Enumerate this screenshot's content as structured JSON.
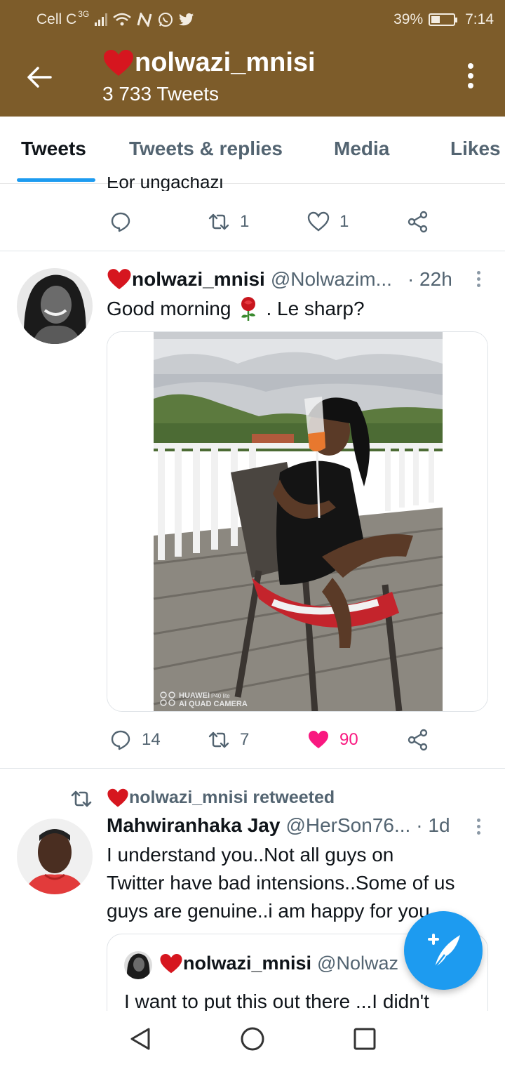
{
  "status_bar": {
    "carrier": "Cell C",
    "network": "3G",
    "battery": "39%",
    "battery_level": 0.39,
    "time": "7:14"
  },
  "header": {
    "name": "nolwazi_mnisi",
    "tweet_count": "3 733 Tweets"
  },
  "tabs": [
    {
      "label": "Tweets",
      "active": true
    },
    {
      "label": "Tweets & replies",
      "active": false
    },
    {
      "label": "Media",
      "active": false
    },
    {
      "label": "Likes",
      "active": false
    }
  ],
  "prev_tweet": {
    "cut_text": "Eor ungachazi",
    "retweets": "1",
    "likes": "1"
  },
  "tweet1": {
    "name": "nolwazi_mnisi",
    "handle": "@Nolwazim...",
    "time": "· 22h",
    "text_before": "Good morning",
    "text_after": ". Le sharp?",
    "watermark_line1": "HUAWEI",
    "watermark_model": "P40 lite",
    "watermark_line2": "AI QUAD CAMERA",
    "replies": "14",
    "retweets": "7",
    "likes": "90"
  },
  "tweet2": {
    "retweet_label": "nolwazi_mnisi retweeted",
    "name": "Mahwiranhaka Jay",
    "handle": "@HerSon76...",
    "time": "· 1d",
    "text_lines": [
      "I understand you..Not all guys on",
      "Twitter have bad intensions..Some of us",
      "guys are genuine..i am happy for you"
    ],
    "quote": {
      "name": "nolwazi_mnisi",
      "handle": "@Nolwaz",
      "text": "I want to put this out there ...I didn't"
    }
  },
  "colors": {
    "header_bg": "#7d5c2a",
    "accent": "#1d9bf0",
    "like_red": "#f91880",
    "muted": "#536471"
  }
}
